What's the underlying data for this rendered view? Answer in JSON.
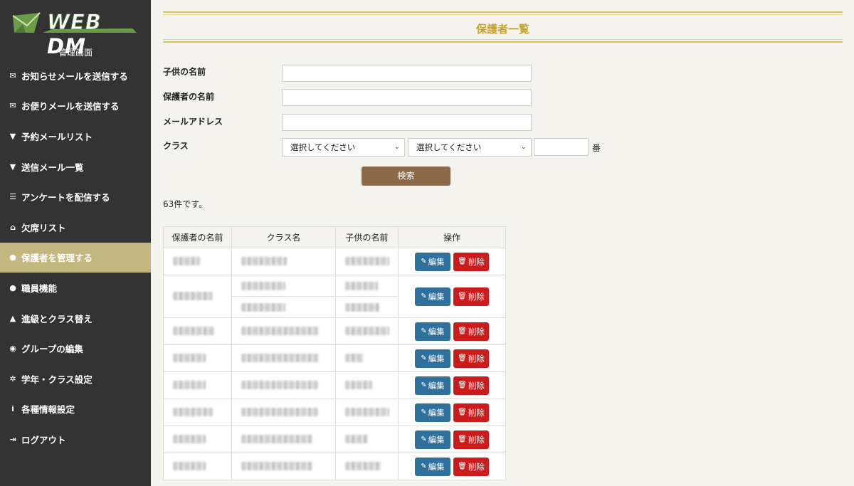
{
  "sidebar": {
    "logo_web": "WEB",
    "logo_dm": "DM",
    "admin_title": "管理画面",
    "items": [
      {
        "label": "お知らせメールを送信する",
        "icon": "envelope-icon",
        "glyph": "✉"
      },
      {
        "label": "お便りメールを送信する",
        "icon": "envelope-icon",
        "glyph": "✉"
      },
      {
        "label": "予約メールリスト",
        "icon": "filter-icon",
        "glyph": "▼"
      },
      {
        "label": "送信メール一覧",
        "icon": "filter-icon",
        "glyph": "▼"
      },
      {
        "label": "アンケートを配信する",
        "icon": "list-icon",
        "glyph": "☰"
      },
      {
        "label": "欠席リスト",
        "icon": "inbox-icon",
        "glyph": "⌂"
      },
      {
        "label": "保護者を管理する",
        "icon": "user-icon",
        "glyph": "●"
      },
      {
        "label": "職員機能",
        "icon": "user-icon",
        "glyph": "●"
      },
      {
        "label": "進級とクラス替え",
        "icon": "graduation-cap-icon",
        "glyph": "▲"
      },
      {
        "label": "グループの編集",
        "icon": "user-circle-icon",
        "glyph": "◉"
      },
      {
        "label": "学年・クラス設定",
        "icon": "gear-icon",
        "glyph": "✲"
      },
      {
        "label": "各種情報設定",
        "icon": "info-icon",
        "glyph": "i"
      },
      {
        "label": "ログアウト",
        "icon": "sign-out-icon",
        "glyph": "⇥"
      }
    ],
    "active_index": 6
  },
  "main": {
    "title": "保護者一覧",
    "form": {
      "child_name_label": "子供の名前",
      "child_name_value": "",
      "parent_name_label": "保護者の名前",
      "parent_name_value": "",
      "email_label": "メールアドレス",
      "email_value": "",
      "class_label": "クラス",
      "grade_select_value": "選択してください",
      "class_select_value": "選択してください",
      "number_value": "",
      "number_suffix": "番",
      "search_button": "検索"
    },
    "result_count": "63件です。",
    "table": {
      "headers": [
        "保護者の名前",
        "クラス名",
        "子供の名前",
        "操作"
      ],
      "edit_label": "編集",
      "delete_label": "削除"
    }
  }
}
